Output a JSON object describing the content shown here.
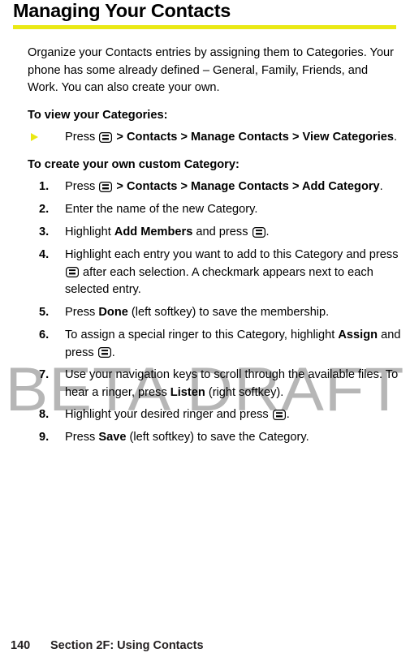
{
  "document": {
    "title": "Managing Your Contacts",
    "accent_color": "#eae915",
    "watermark": "BETA DRAFT",
    "watermark_color": "#b6b6b6"
  },
  "intro": {
    "paragraph": "Organize your Contacts entries by assigning them to Categories. Your phone has some already defined – General, Family, Friends, and Work. You can also create your own."
  },
  "view_section": {
    "heading": "To view your Categories:",
    "bullet_icon": "triangle-right-bullet",
    "step": {
      "prefix": "Press ",
      "key_icon": "menu-ok-key-icon",
      "path": " > Contacts > Manage Contacts > View Categories",
      "suffix": "."
    }
  },
  "create_section": {
    "heading": "To create your own custom Category:",
    "steps": [
      {
        "number": "1.",
        "prefix": "Press ",
        "key_icon": "menu-ok-key-icon",
        "bold_path": " > Contacts > Manage Contacts > Add Category",
        "suffix": "."
      },
      {
        "number": "2.",
        "text": "Enter the name of the new Category."
      },
      {
        "number": "3.",
        "prefix": "Highlight ",
        "bold_1": "Add Members",
        "middle": " and press ",
        "key_icon": "menu-ok-key-icon",
        "suffix": "."
      },
      {
        "number": "4.",
        "prefix": "Highlight each entry you want to add to this Category and press ",
        "key_icon": "menu-ok-key-icon",
        "suffix": " after each selection. A checkmark appears next to each selected entry."
      },
      {
        "number": "5.",
        "prefix": "Press ",
        "bold_1": "Done",
        "suffix": " (left softkey) to save the membership."
      },
      {
        "number": "6.",
        "prefix": "To assign a special ringer to this Category, highlight ",
        "bold_1": "Assign",
        "middle": " and press ",
        "key_icon": "menu-ok-key-icon",
        "suffix": "."
      },
      {
        "number": "7.",
        "prefix": "Use your navigation keys to scroll through the available files. To hear a ringer, press ",
        "bold_1": "Listen",
        "suffix": " (right softkey)."
      },
      {
        "number": "8.",
        "prefix": "Highlight your desired ringer and press ",
        "key_icon": "menu-ok-key-icon",
        "suffix": "."
      },
      {
        "number": "9.",
        "prefix": "Press ",
        "bold_1": "Save",
        "suffix": " (left softkey) to save the Category."
      }
    ]
  },
  "footer": {
    "page_number": "140",
    "section_label": "Section 2F: Using Contacts"
  }
}
